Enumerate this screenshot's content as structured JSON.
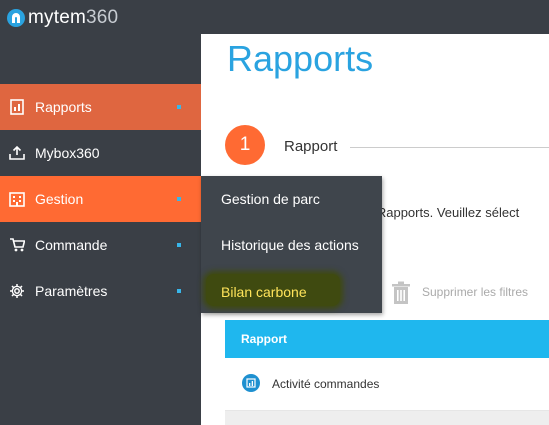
{
  "app": {
    "logo_prefix": "mytem",
    "logo_suffix": "360"
  },
  "sidebar": {
    "items": [
      {
        "label": "Rapports",
        "icon": "report-icon"
      },
      {
        "label": "Mybox360",
        "icon": "inbox-tray-icon"
      },
      {
        "label": "Gestion",
        "icon": "building-icon"
      },
      {
        "label": "Commande",
        "icon": "cart-icon"
      },
      {
        "label": "Paramètres",
        "icon": "gear-icon"
      }
    ]
  },
  "submenu": {
    "items": [
      {
        "label": "Gestion de parc"
      },
      {
        "label": "Historique des actions"
      },
      {
        "label": "Bilan carbone"
      }
    ]
  },
  "main": {
    "title": "Rapports",
    "step": {
      "number": "1",
      "label": "Rapport"
    },
    "info_text": "e Rapports. Veuillez sélect",
    "remove_filters": "Supprimer les filtres",
    "table": {
      "header": "Rapport",
      "rows": [
        {
          "label": "Activité commandes"
        }
      ]
    }
  },
  "colors": {
    "sidebar_bg": "#3a3f46",
    "active_orange": "#ff6a33",
    "rapports_bg": "#df6640",
    "accent_blue": "#2aa3e0",
    "table_header": "#1fb7ee",
    "highlight_text": "#ffe45a"
  }
}
